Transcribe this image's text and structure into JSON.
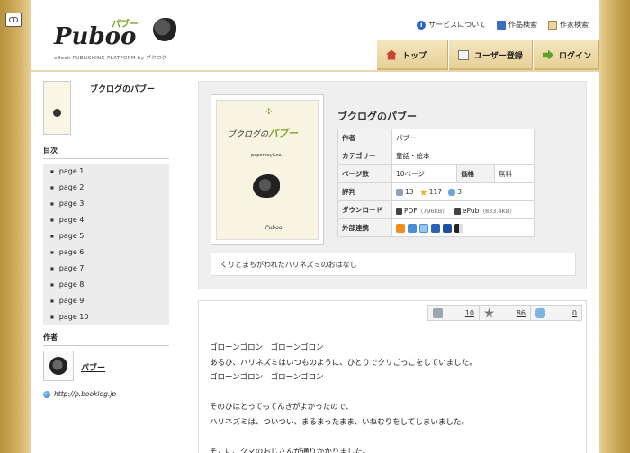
{
  "header": {
    "logo_text": "Puboo",
    "logo_kana": "パブー",
    "logo_subtitle": "eBook PUBLISHING PLATFORM by ブクログ",
    "links": [
      {
        "label": "サービスについて",
        "icon": "info-icon"
      },
      {
        "label": "作品検索",
        "icon": "book-search-icon"
      },
      {
        "label": "作家検索",
        "icon": "author-search-icon"
      }
    ],
    "nav": [
      {
        "label": "トップ",
        "icon": "home-icon"
      },
      {
        "label": "ユーザー登録",
        "icon": "register-icon"
      },
      {
        "label": "ログイン",
        "icon": "login-arrow-icon"
      }
    ]
  },
  "sidebar": {
    "book_title": "ブクログのパブー",
    "toc_heading": "目次",
    "toc": [
      "page 1",
      "page 2",
      "page 3",
      "page 4",
      "page 5",
      "page 6",
      "page 7",
      "page 8",
      "page 9",
      "page 10"
    ],
    "author_heading": "作者",
    "author_name": "パブー",
    "author_url": "http://p.booklog.jp"
  },
  "book": {
    "cover_title_a": "ブクログの",
    "cover_title_b": "パブー",
    "cover_sub": "paperboy&co.",
    "cover_logo": "Puboo",
    "title": "ブクログのパブー",
    "labels": {
      "author": "作者",
      "category": "カテゴリー",
      "pages": "ページ数",
      "price": "価格",
      "rating": "評判",
      "download": "ダウンロード",
      "external": "外部連携"
    },
    "author": "パブー",
    "category": "童話・絵本",
    "pages": "10ページ",
    "price": "無料",
    "rating_clips": "13",
    "rating_stars": "117",
    "rating_comments": "3",
    "pdf_label": "PDF",
    "pdf_size": "（796KB）",
    "epub_label": "ePub",
    "epub_size": "（833.4KB）",
    "description": "くりとまちがわれたハリネズミのおはなし"
  },
  "stats": {
    "clips": "10",
    "stars": "86",
    "comments": "0"
  },
  "story": [
    "ゴローンゴロン　ゴローンゴロン",
    "あるひ、ハリネズミはいつものように、ひとりでクリごっこをしていました。",
    "ゴローンゴロン　ゴローンゴロン",
    "",
    "そのひはとってもてんきがよかったので、",
    "ハリネズミは、ついつい、まるまったまま、いねむりをしてしまいました。",
    "",
    "そこに、クマのおじさんが通りかかりました。"
  ],
  "colors": {
    "accent_green": "#7da42a",
    "nav_bg": "#e6cf95",
    "frame": "#e7d09a"
  }
}
